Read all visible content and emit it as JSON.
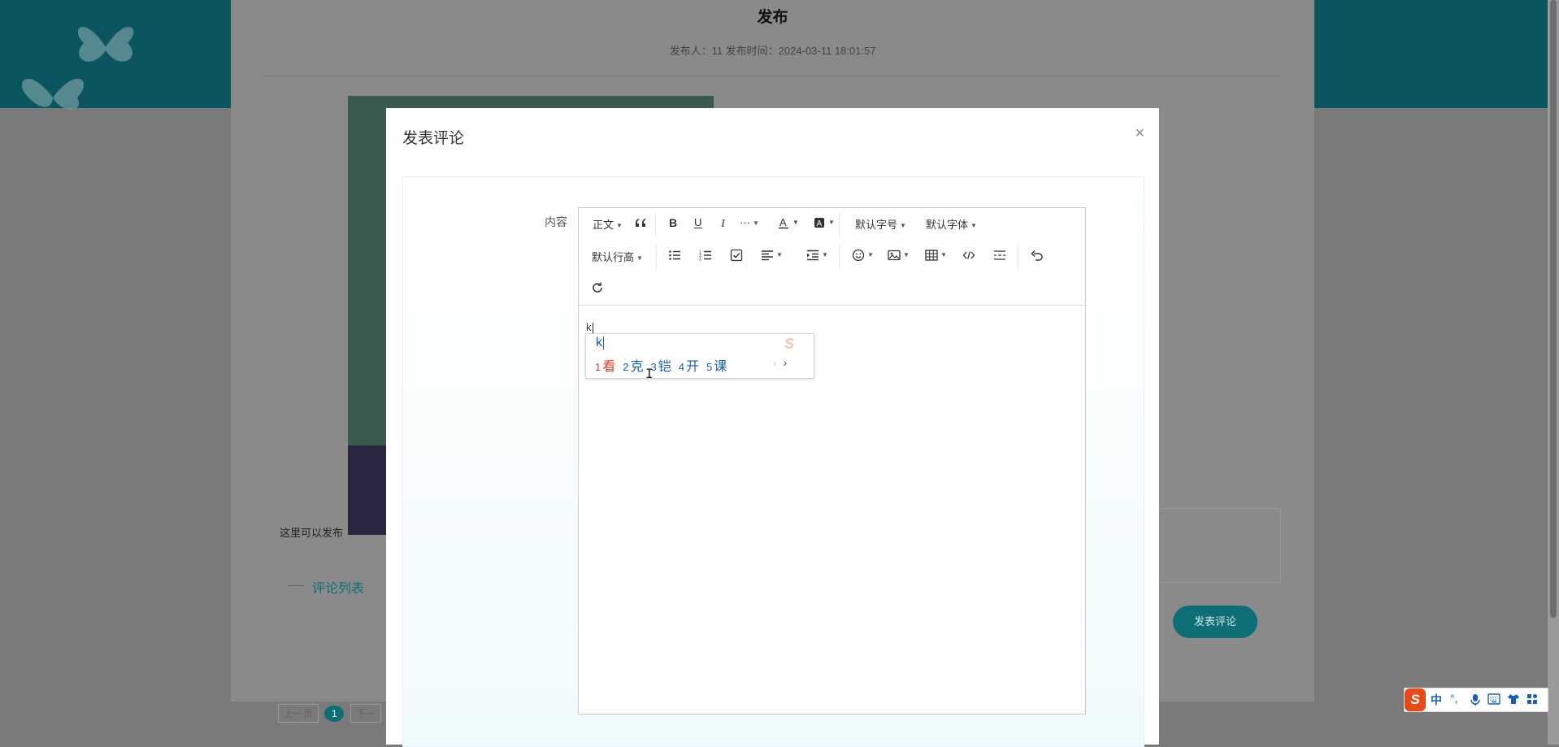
{
  "background": {
    "title": "发布",
    "meta": "发布人：11  发布时间：2024-03-11 18:01:57",
    "body_text": "这里可以发布",
    "comment_tab": "评论列表",
    "submit_button": "发表评论",
    "pager": {
      "prev": "上一页",
      "current": "1",
      "next": "下一"
    }
  },
  "modal": {
    "title": "发表评论",
    "close_glyph": "×",
    "content_label": "内容"
  },
  "toolbar": {
    "heading": "正文",
    "font_size": "默认字号",
    "font_family": "默认字体",
    "line_height": "默认行高",
    "more": "···"
  },
  "editor": {
    "typed_text": "k"
  },
  "ime": {
    "input": "k",
    "candidates": [
      {
        "num": "1",
        "text": "看"
      },
      {
        "num": "2",
        "text": "克"
      },
      {
        "num": "3",
        "text": "铠"
      },
      {
        "num": "4",
        "text": "开"
      },
      {
        "num": "5",
        "text": "课"
      }
    ],
    "prev": "‹",
    "next": "›",
    "status": {
      "logo": "S",
      "lang": "中",
      "punct": "°,"
    }
  }
}
